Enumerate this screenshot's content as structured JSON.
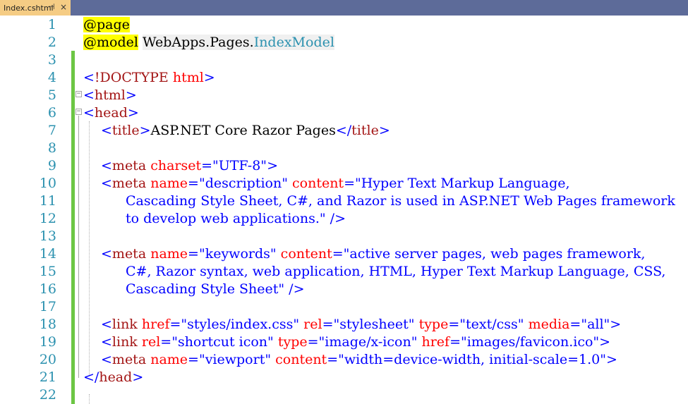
{
  "tab": {
    "filename": "Index.cshtml",
    "pin_glyph": "⊣",
    "close_glyph": "×"
  },
  "lines": [
    {
      "n": "1",
      "indent": 0,
      "tokens": [
        [
          "dir",
          "@page"
        ]
      ]
    },
    {
      "n": "2",
      "indent": 0,
      "tokens": [
        [
          "dir",
          "@model"
        ],
        [
          "txt",
          " "
        ],
        [
          "ns",
          "WebApps.Pages."
        ],
        [
          "type",
          "IndexModel"
        ]
      ]
    },
    {
      "n": "3",
      "indent": 0,
      "tokens": []
    },
    {
      "n": "4",
      "indent": 0,
      "tokens": [
        [
          "brk",
          "<"
        ],
        [
          "tag",
          "!DOCTYPE"
        ],
        [
          "txt",
          " "
        ],
        [
          "attr",
          "html"
        ],
        [
          "brk",
          ">"
        ]
      ]
    },
    {
      "n": "5",
      "indent": 0,
      "tokens": [
        [
          "brk",
          "<"
        ],
        [
          "tag",
          "html"
        ],
        [
          "brk",
          ">"
        ]
      ]
    },
    {
      "n": "6",
      "indent": 0,
      "tokens": [
        [
          "brk",
          "<"
        ],
        [
          "tag",
          "head"
        ],
        [
          "brk",
          ">"
        ]
      ]
    },
    {
      "n": "7",
      "indent": 1,
      "tokens": [
        [
          "brk",
          "<"
        ],
        [
          "tag",
          "title"
        ],
        [
          "brk",
          ">"
        ],
        [
          "txt",
          "ASP.NET Core Razor Pages"
        ],
        [
          "brk",
          "</"
        ],
        [
          "tag",
          "title"
        ],
        [
          "brk",
          ">"
        ]
      ]
    },
    {
      "n": "8",
      "indent": 0,
      "tokens": []
    },
    {
      "n": "9",
      "indent": 1,
      "tokens": [
        [
          "brk",
          "<"
        ],
        [
          "tag",
          "meta"
        ],
        [
          "txt",
          " "
        ],
        [
          "attr",
          "charset"
        ],
        [
          "brk",
          "="
        ],
        [
          "val",
          "\"UTF-8\""
        ],
        [
          "brk",
          ">"
        ]
      ]
    },
    {
      "n": "10",
      "indent": 1,
      "tokens": [
        [
          "brk",
          "<"
        ],
        [
          "tag",
          "meta"
        ],
        [
          "txt",
          " "
        ],
        [
          "attr",
          "name"
        ],
        [
          "brk",
          "="
        ],
        [
          "val",
          "\"description\""
        ],
        [
          "txt",
          " "
        ],
        [
          "attr",
          "content"
        ],
        [
          "brk",
          "="
        ],
        [
          "val",
          "\"Hyper Text Markup Language,"
        ]
      ]
    },
    {
      "n": "11",
      "indent": 2,
      "tokens": [
        [
          "val",
          "Cascading Style Sheet, C#, and Razor is used in ASP.NET Web Pages framework"
        ]
      ]
    },
    {
      "n": "12",
      "indent": 2,
      "tokens": [
        [
          "val",
          "to develop web applications.\""
        ],
        [
          "txt",
          " "
        ],
        [
          "brk",
          "/>"
        ]
      ]
    },
    {
      "n": "13",
      "indent": 0,
      "tokens": []
    },
    {
      "n": "14",
      "indent": 1,
      "tokens": [
        [
          "brk",
          "<"
        ],
        [
          "tag",
          "meta"
        ],
        [
          "txt",
          " "
        ],
        [
          "attr",
          "name"
        ],
        [
          "brk",
          "="
        ],
        [
          "val",
          "\"keywords\""
        ],
        [
          "txt",
          " "
        ],
        [
          "attr",
          "content"
        ],
        [
          "brk",
          "="
        ],
        [
          "val",
          "\"active server pages, web pages framework,"
        ]
      ]
    },
    {
      "n": "15",
      "indent": 2,
      "tokens": [
        [
          "val",
          "C#, Razor syntax, web application, HTML, Hyper Text Markup Language, CSS,"
        ]
      ]
    },
    {
      "n": "16",
      "indent": 2,
      "tokens": [
        [
          "val",
          "Cascading Style Sheet\""
        ],
        [
          "txt",
          " "
        ],
        [
          "brk",
          "/>"
        ]
      ]
    },
    {
      "n": "17",
      "indent": 0,
      "tokens": []
    },
    {
      "n": "18",
      "indent": 1,
      "tokens": [
        [
          "brk",
          "<"
        ],
        [
          "tag",
          "link"
        ],
        [
          "txt",
          " "
        ],
        [
          "attr",
          "href"
        ],
        [
          "brk",
          "="
        ],
        [
          "val",
          "\"styles/index.css\""
        ],
        [
          "txt",
          " "
        ],
        [
          "attr",
          "rel"
        ],
        [
          "brk",
          "="
        ],
        [
          "val",
          "\"stylesheet\""
        ],
        [
          "txt",
          " "
        ],
        [
          "attr",
          "type"
        ],
        [
          "brk",
          "="
        ],
        [
          "val",
          "\"text/css\""
        ],
        [
          "txt",
          " "
        ],
        [
          "attr",
          "media"
        ],
        [
          "brk",
          "="
        ],
        [
          "val",
          "\"all\""
        ],
        [
          "brk",
          ">"
        ]
      ]
    },
    {
      "n": "19",
      "indent": 1,
      "tokens": [
        [
          "brk",
          "<"
        ],
        [
          "tag",
          "link"
        ],
        [
          "txt",
          " "
        ],
        [
          "attr",
          "rel"
        ],
        [
          "brk",
          "="
        ],
        [
          "val",
          "\"shortcut icon\""
        ],
        [
          "txt",
          " "
        ],
        [
          "attr",
          "type"
        ],
        [
          "brk",
          "="
        ],
        [
          "val",
          "\"image/x-icon\""
        ],
        [
          "txt",
          " "
        ],
        [
          "attr",
          "href"
        ],
        [
          "brk",
          "="
        ],
        [
          "val",
          "\"images/favicon.ico\""
        ],
        [
          "brk",
          ">"
        ]
      ]
    },
    {
      "n": "20",
      "indent": 1,
      "tokens": [
        [
          "brk",
          "<"
        ],
        [
          "tag",
          "meta"
        ],
        [
          "txt",
          " "
        ],
        [
          "attr",
          "name"
        ],
        [
          "brk",
          "="
        ],
        [
          "val",
          "\"viewport\""
        ],
        [
          "txt",
          " "
        ],
        [
          "attr",
          "content"
        ],
        [
          "brk",
          "="
        ],
        [
          "val",
          "\"width=device-width, initial-scale=1.0\""
        ],
        [
          "brk",
          ">"
        ]
      ]
    },
    {
      "n": "21",
      "indent": 0,
      "tokens": [
        [
          "brk",
          "</"
        ],
        [
          "tag",
          "head"
        ],
        [
          "brk",
          ">"
        ]
      ]
    },
    {
      "n": "22",
      "indent": 0,
      "tokens": []
    }
  ]
}
